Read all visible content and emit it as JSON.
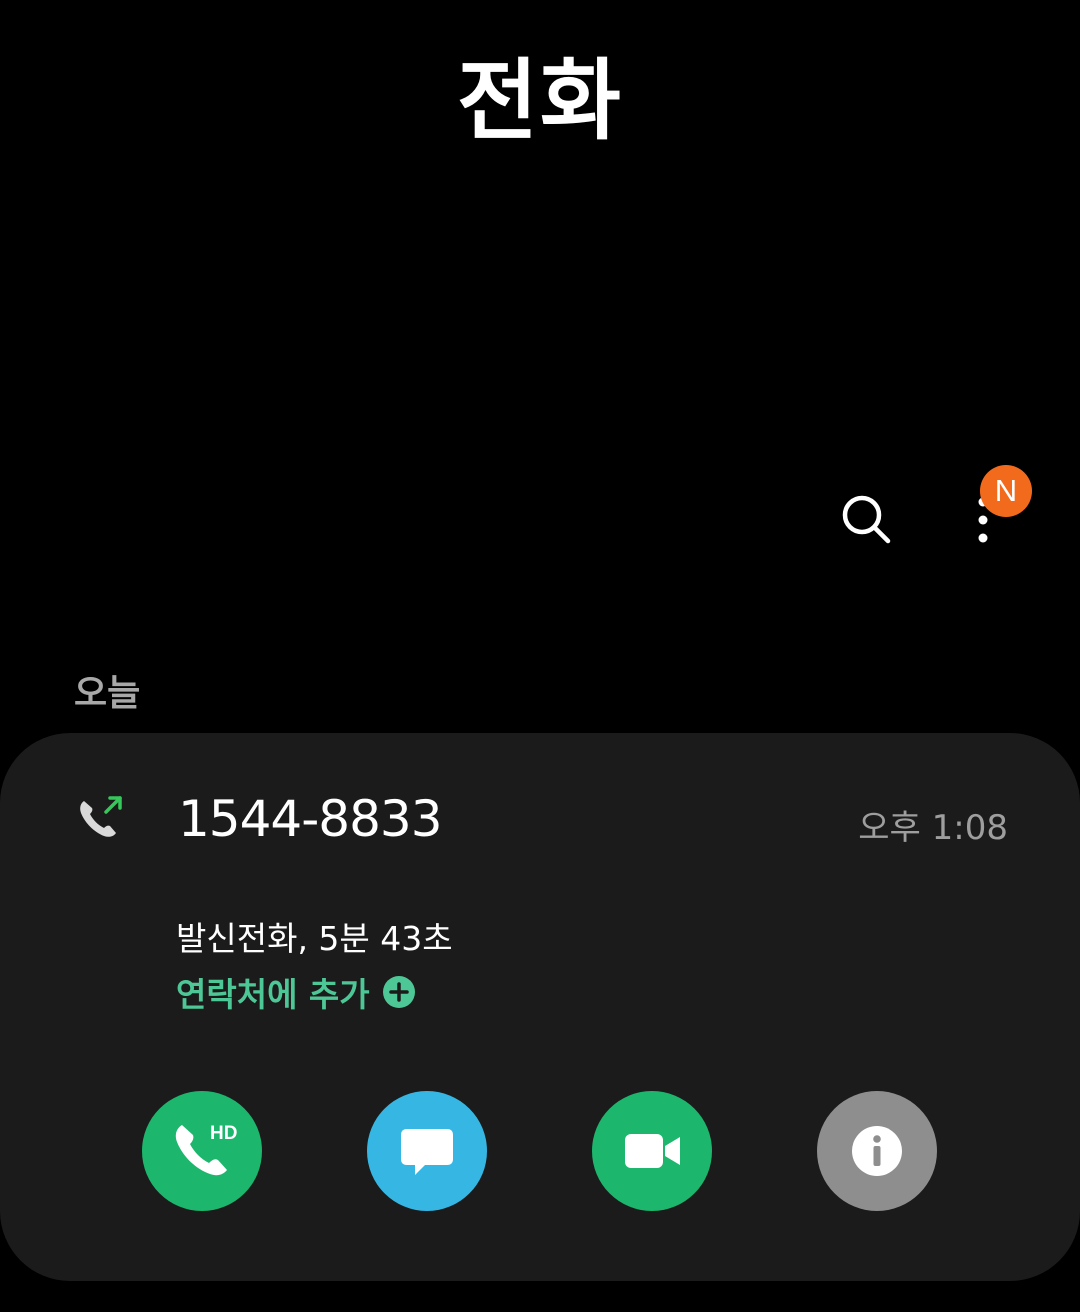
{
  "header": {
    "title": "전화"
  },
  "toolbar": {
    "search_icon": "search-icon",
    "more_icon": "more-vert-icon",
    "badge_text": "N",
    "badge_color": "#f26b1d"
  },
  "log": {
    "section_label": "오늘",
    "entries": [
      {
        "call_type_icon": "outgoing-call-icon",
        "number": "1544-8833",
        "time": "오후 1:08",
        "detail": "발신전화, 5분 43초",
        "add_contact_label": "연락처에 추가",
        "actions": [
          {
            "name": "hd-voice-call",
            "icon": "hd-call-icon",
            "color": "#1db66d"
          },
          {
            "name": "message",
            "icon": "message-icon",
            "color": "#36b6e3"
          },
          {
            "name": "video-call",
            "icon": "video-icon",
            "color": "#1db66d"
          },
          {
            "name": "details",
            "icon": "info-icon",
            "color": "#8e8e8e"
          }
        ]
      }
    ]
  },
  "colors": {
    "background": "#000000",
    "card": "#1b1b1b",
    "accent_green": "#4dc796",
    "outgoing_arrow": "#35c759"
  }
}
